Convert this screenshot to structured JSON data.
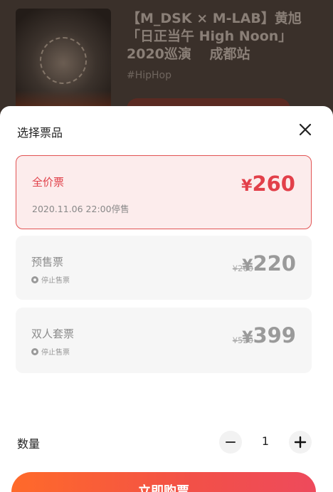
{
  "event": {
    "title_line1": "【M_DSK × M-LAB】黄旭",
    "title_line2": "「日正当午 High Noon」",
    "title_line3": "2020巡演　 成都站",
    "tag": "#HipHop"
  },
  "sheet": {
    "title": "选择票品",
    "tickets": [
      {
        "name": "全价票",
        "sub": "2020.11.06 22:00停售",
        "price_symbol": "¥",
        "price": "260",
        "original": ""
      },
      {
        "name": "预售票",
        "sub": "停止售票",
        "price_symbol": "¥",
        "price": "220",
        "original": "¥260"
      },
      {
        "name": "双人套票",
        "sub": "停止售票",
        "price_symbol": "¥",
        "price": "399",
        "original": "¥520"
      }
    ],
    "quantity_label": "数量",
    "quantity": "1",
    "buy_label": "立即购票"
  },
  "colors": {
    "accent": "#e2404a",
    "buy_gradient_start": "#ff6a2a",
    "buy_gradient_end": "#ee4a5c"
  },
  "icons": {
    "close": "close-icon",
    "minus": "minus-icon",
    "plus": "plus-icon",
    "stop": "stop-sale-icon"
  }
}
